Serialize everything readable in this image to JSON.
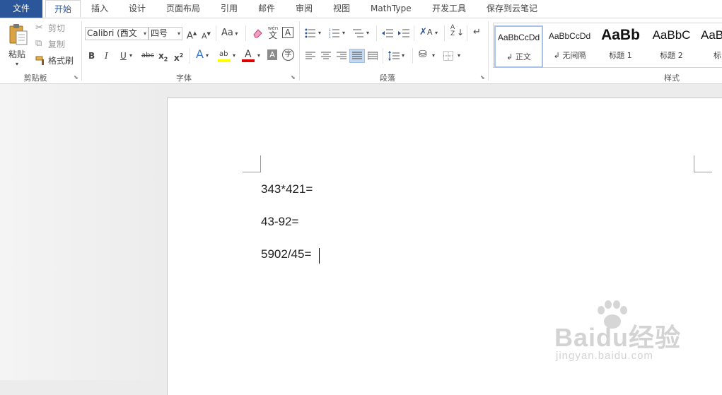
{
  "tabs": [
    "文件",
    "开始",
    "插入",
    "设计",
    "页面布局",
    "引用",
    "邮件",
    "审阅",
    "视图",
    "MathType",
    "开发工具",
    "保存到云笔记"
  ],
  "clipboard": {
    "paste": "粘贴",
    "cut": "剪切",
    "copy": "复制",
    "format_painter": "格式刷",
    "group": "剪贴板"
  },
  "font": {
    "name": "Calibri (西文",
    "size": "四号",
    "change_case": "Aa",
    "phonetic_top": "wén",
    "phonetic_bottom": "文",
    "border_char": "A",
    "bold": "B",
    "italic": "I",
    "underline": "U",
    "strike": "abc",
    "subscript": "x",
    "sub2": "2",
    "superscript": "x",
    "sup2": "2",
    "effects": "A",
    "highlight": "ab",
    "color": "A",
    "shade": "A",
    "enclose": "字",
    "group": "字体"
  },
  "paragraph": {
    "group": "段落"
  },
  "styles": {
    "items": [
      {
        "sample": "AaBbCcDd",
        "name": "↲ 正文"
      },
      {
        "sample": "AaBbCcDd",
        "name": "↲ 无间隔"
      },
      {
        "sample": "AaBb",
        "name": "标题 1"
      },
      {
        "sample": "AaBbC",
        "name": "标题 2"
      },
      {
        "sample": "AaB",
        "name": "标"
      }
    ],
    "group": "样式"
  },
  "document": {
    "lines": [
      "343*421=",
      "43-92=",
      "5902/45="
    ]
  },
  "watermark": {
    "brand": "Baidu经验",
    "url": "jingyan.baidu.com"
  },
  "colors": {
    "file_tab": "#2b579a",
    "highlight": "#ffff00",
    "font_color": "#e00000",
    "active_text": "#2b579a"
  }
}
